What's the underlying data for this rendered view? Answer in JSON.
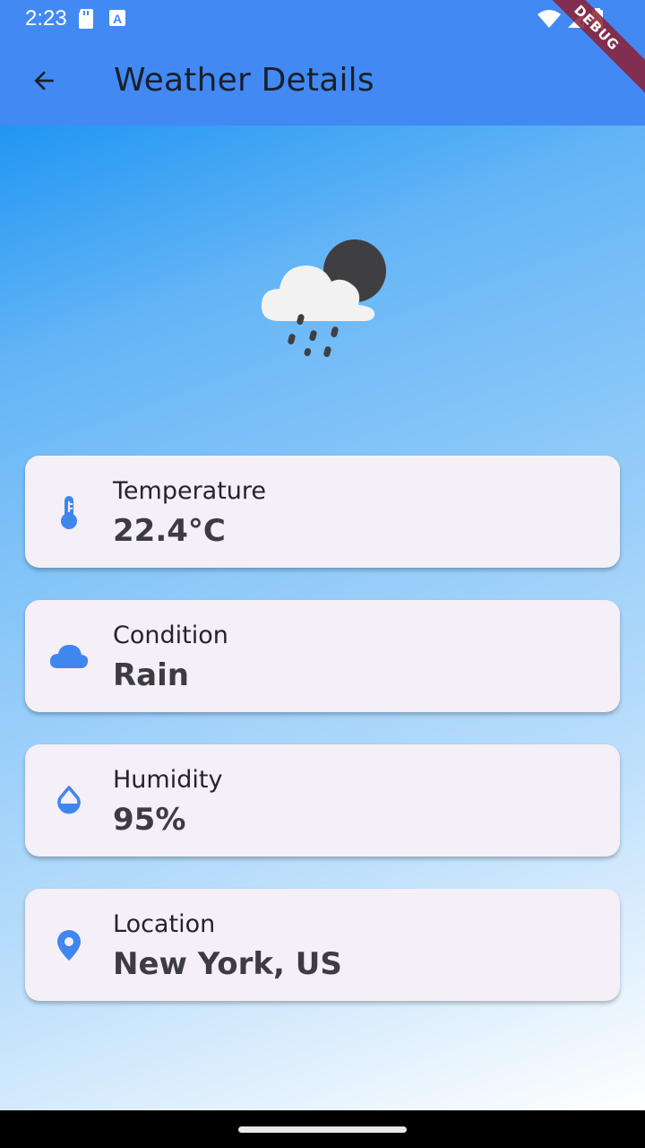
{
  "status_bar": {
    "time": "2:23",
    "debug_label": "DEBUG"
  },
  "app_bar": {
    "title": "Weather Details",
    "back_icon": "arrow-back-icon"
  },
  "weather_icon": "cloud-rain-night-icon",
  "cards": [
    {
      "icon": "thermometer-icon",
      "label": "Temperature",
      "value": "22.4°C"
    },
    {
      "icon": "cloud-icon",
      "label": "Condition",
      "value": "Rain"
    },
    {
      "icon": "water-drop-icon",
      "label": "Humidity",
      "value": "95%"
    },
    {
      "icon": "location-pin-icon",
      "label": "Location",
      "value": "New York, US"
    }
  ],
  "colors": {
    "primary": "#4289f4",
    "card_bg": "#f5eff7",
    "icon_accent": "#3f86ef"
  }
}
